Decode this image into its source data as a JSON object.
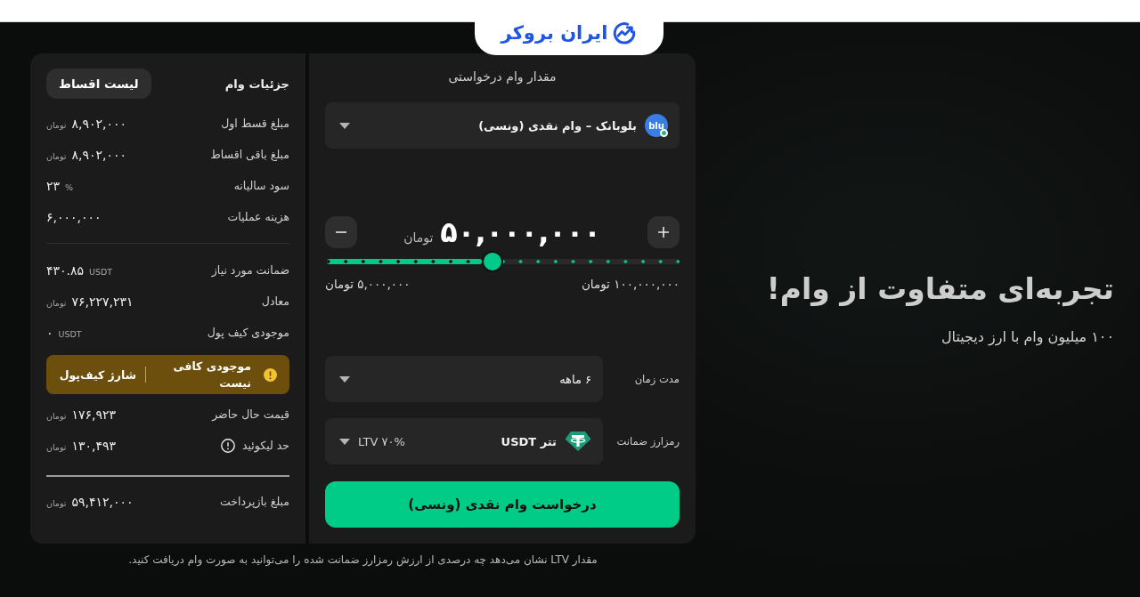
{
  "header": {
    "logo_text": "ایران بروکر"
  },
  "loan_request": {
    "title": "مقدار وام درخواستی",
    "product": {
      "logo_text": "blu",
      "label": "بلوبانک – وام نقدی (ونسی)"
    },
    "amount": {
      "value": "۵۰,۰۰۰,۰۰۰",
      "unit": "تومان"
    },
    "slider": {
      "level": 0.47,
      "max_label": "۱۰۰,۰۰۰,۰۰۰ تومان",
      "min_label": "۵,۰۰۰,۰۰۰ تومان"
    },
    "duration": {
      "label": "مدت زمان",
      "value": "۶ ماهه"
    },
    "collateral": {
      "label": "رمزارز ضمانت",
      "value": "تتر USDT",
      "ltv": "LTV ۷۰%"
    },
    "submit_button": "درخواست وام نقدی (ونسی)"
  },
  "loan_details": {
    "title": "جزئیات وام",
    "installments_button": "لیست اقساط",
    "cost_rows": [
      {
        "label": "مبلغ قسط اول",
        "value": "۸,۹۰۲,۰۰۰",
        "unit": "تومان"
      },
      {
        "label": "مبلغ باقی اقساط",
        "value": "۸,۹۰۲,۰۰۰",
        "unit": "تومان"
      },
      {
        "label": "سود سالیانه",
        "value": "۲۳",
        "unit": "%"
      },
      {
        "label": "هزینه عملیات",
        "value": "۶,۰۰۰,۰۰۰"
      }
    ],
    "collateral_rows": [
      {
        "label": "ضمانت مورد نیاز",
        "value": "۴۳۰.۸۵",
        "unit": "USDT"
      },
      {
        "label": "معادل",
        "value": "۷۶,۲۲۷,۲۳۱",
        "unit": "تومان"
      },
      {
        "label": "موجودی کیف پول",
        "value": "۰",
        "unit": "USDT"
      }
    ],
    "balance_alert": {
      "message": "موجودی کافی نیست",
      "action": "شارژ کیف‌پول"
    },
    "price_rows": [
      {
        "label": "قیمت حال حاضر",
        "value": "۱۷۶,۹۲۳",
        "unit": "تومان",
        "info": false
      },
      {
        "label": "حد لیکوئید",
        "value": "۱۳۰,۴۹۳",
        "unit": "تومان",
        "info": true
      }
    ],
    "total_row": {
      "label": "مبلغ بازپرداخت",
      "value": "۵۹,۴۱۲,۰۰۰",
      "unit": "تومان"
    }
  },
  "footnote": "مقدار LTV نشان می‌دهد چه درصدی از ارزش رمزارز ضمانت شده را می‌توانید به صورت وام دریافت کنید.",
  "hero": {
    "title": "تجربه‌ای متفاوت از وام!",
    "subtitle": "۱۰۰ میلیون وام با ارز دیجیتال"
  }
}
